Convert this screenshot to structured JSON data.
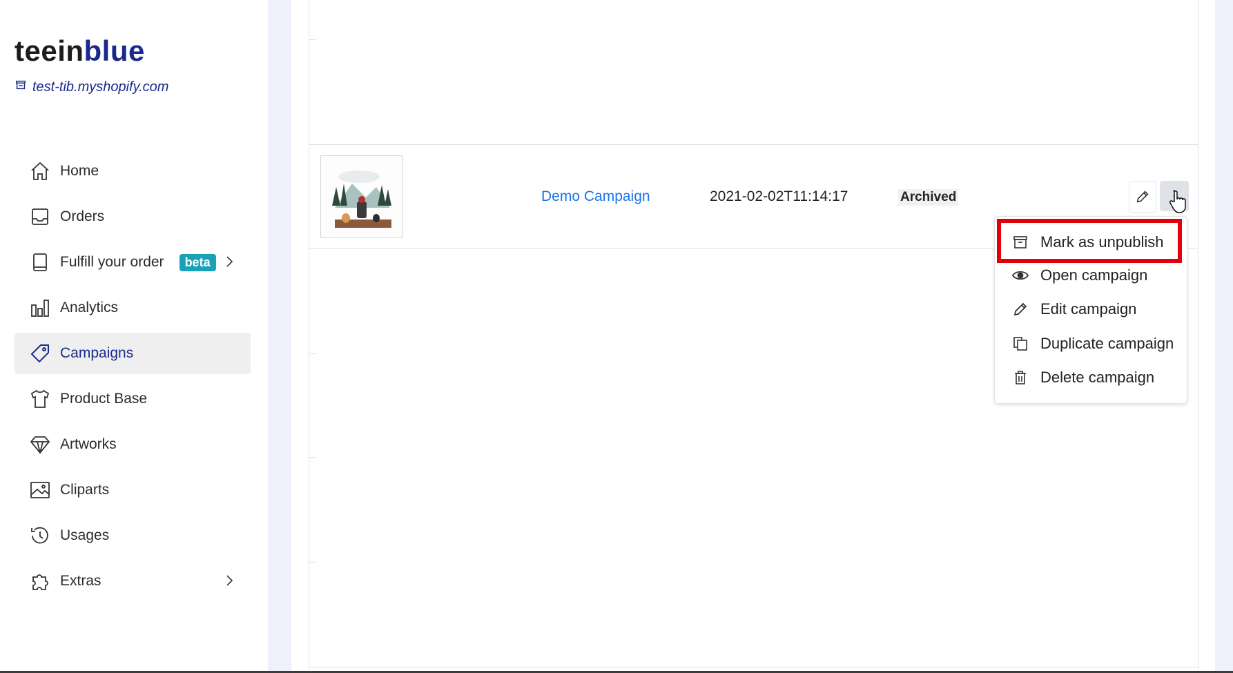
{
  "brand": {
    "part1": "teein",
    "part2": "blue",
    "store": "test-tib.myshopify.com"
  },
  "nav": {
    "home": "Home",
    "orders": "Orders",
    "fulfill": "Fulfill your order",
    "fulfill_badge": "beta",
    "analytics": "Analytics",
    "campaigns": "Campaigns",
    "product_base": "Product Base",
    "artworks": "Artworks",
    "cliparts": "Cliparts",
    "usages": "Usages",
    "extras": "Extras",
    "active": "Campaigns"
  },
  "row": {
    "campaign_name": "Demo Campaign",
    "date": "2021-02-02T11:14:17",
    "status": "Archived"
  },
  "menu": {
    "mark_unpublish": "Mark as unpublish",
    "open": "Open campaign",
    "edit": "Edit campaign",
    "duplicate": "Duplicate campaign",
    "delete": "Delete campaign"
  },
  "colors": {
    "accent": "#1a2a8c",
    "link": "#1a73e8",
    "badge": "#17a2b8",
    "highlight": "#e0000b"
  },
  "icons": [
    "store-icon",
    "home-icon",
    "inbox-icon",
    "book-icon",
    "bar-chart-icon",
    "tag-icon",
    "tshirt-icon",
    "diamond-icon",
    "image-icon",
    "history-icon",
    "puzzle-icon",
    "pencil-icon",
    "more-icon",
    "archive-icon",
    "eye-icon",
    "copy-icon",
    "trash-icon"
  ]
}
